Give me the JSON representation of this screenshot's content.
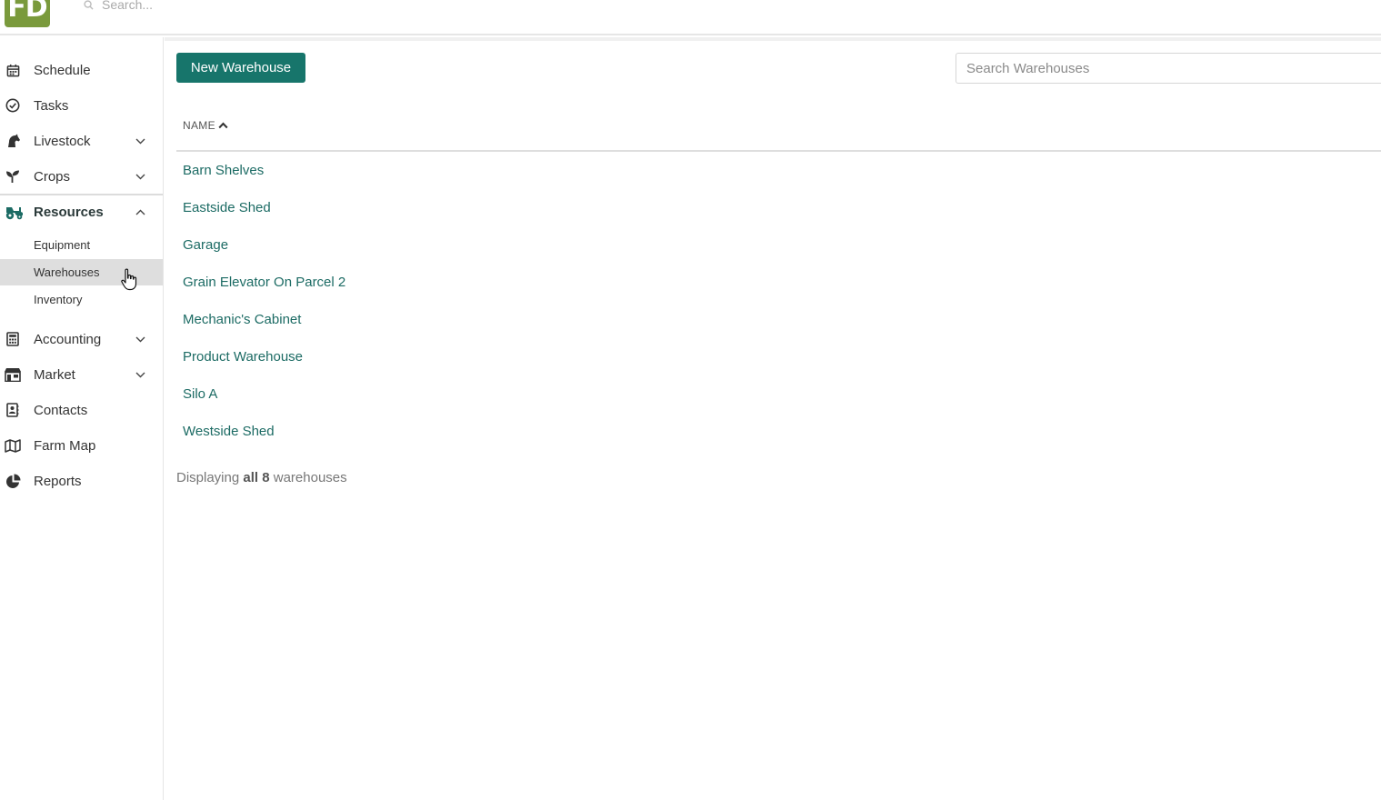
{
  "app": {
    "logo_text": "FD",
    "search_placeholder": "Search..."
  },
  "colors": {
    "brand_green": "#7a9a3c",
    "primary_teal": "#17756b",
    "link_teal": "#1c6b64"
  },
  "sidebar": {
    "items": [
      {
        "label": "Schedule",
        "icon": "calendar-icon"
      },
      {
        "label": "Tasks",
        "icon": "check-circle-icon"
      },
      {
        "label": "Livestock",
        "icon": "horse-icon",
        "expandable": true
      },
      {
        "label": "Crops",
        "icon": "seedling-icon",
        "expandable": true
      },
      {
        "label": "Resources",
        "icon": "tractor-icon",
        "expanded": true,
        "active": true
      },
      {
        "label": "Accounting",
        "icon": "calculator-icon",
        "expandable": true
      },
      {
        "label": "Market",
        "icon": "store-icon",
        "expandable": true
      },
      {
        "label": "Contacts",
        "icon": "address-book-icon"
      },
      {
        "label": "Farm Map",
        "icon": "map-icon"
      },
      {
        "label": "Reports",
        "icon": "pie-chart-icon"
      }
    ],
    "resources_sub": [
      {
        "label": "Equipment"
      },
      {
        "label": "Warehouses",
        "selected": true
      },
      {
        "label": "Inventory"
      }
    ]
  },
  "main": {
    "new_button_label": "New Warehouse",
    "search_placeholder": "Search Warehouses",
    "column_header": "NAME",
    "sort_icon": "chevron-up-icon",
    "rows": [
      "Barn Shelves",
      "Eastside Shed",
      "Garage",
      "Grain Elevator On Parcel 2",
      "Mechanic's Cabinet",
      "Product Warehouse",
      "Silo A",
      "Westside Shed"
    ],
    "footer": {
      "prefix": "Displaying",
      "all": "all",
      "count": "8",
      "suffix": "warehouses"
    }
  }
}
